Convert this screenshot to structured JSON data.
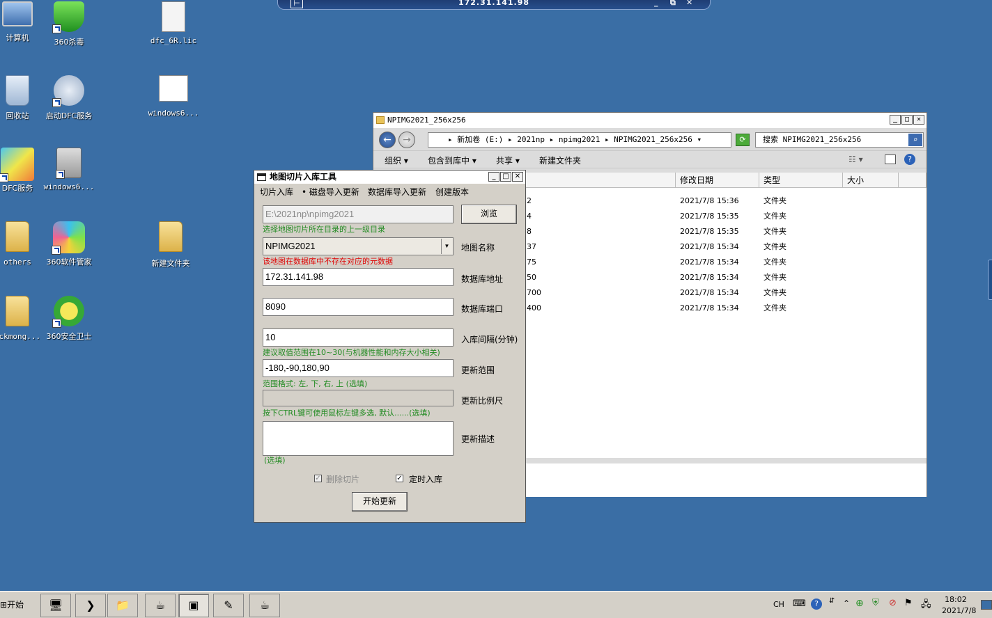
{
  "remote": {
    "ip": "172.31.141.98",
    "pin": "⊢",
    "min": "_",
    "restore": "⧉",
    "close": "✕"
  },
  "desktop": {
    "icons": [
      {
        "label": "计算机"
      },
      {
        "label": "360杀毒"
      },
      {
        "label": "dfc_6R.lic"
      },
      {
        "label": "回收站"
      },
      {
        "label": "启动DFC服务"
      },
      {
        "label": "windows6..."
      },
      {
        "label": "DFC服务"
      },
      {
        "label": "windows6..."
      },
      {
        "label": "others"
      },
      {
        "label": "360软件管家"
      },
      {
        "label": "新建文件夹"
      },
      {
        "label": "ockmong..."
      },
      {
        "label": "360安全卫士"
      }
    ]
  },
  "explorer": {
    "title": "NPIMG2021_256x256",
    "back": "←",
    "forward": "→",
    "address": "▸ 新加卷 (E:) ▸ 2021np ▸ npimg2021 ▸ NPIMG2021_256x256 ▾",
    "search_placeholder": "搜索 NPIMG2021_256x256",
    "toolbar": {
      "organize": "组织 ▾",
      "include": "包含到库中 ▾",
      "share": "共享 ▾",
      "new_folder": "新建文件夹"
    },
    "columns": {
      "modified": "修改日期",
      "type": "类型",
      "size": "大小"
    },
    "rows": [
      {
        "name": "2",
        "modified": "2021/7/8 15:36",
        "type": "文件夹"
      },
      {
        "name": "4",
        "modified": "2021/7/8 15:35",
        "type": "文件夹"
      },
      {
        "name": "8",
        "modified": "2021/7/8 15:35",
        "type": "文件夹"
      },
      {
        "name": "37",
        "modified": "2021/7/8 15:34",
        "type": "文件夹"
      },
      {
        "name": "75",
        "modified": "2021/7/8 15:34",
        "type": "文件夹"
      },
      {
        "name": "50",
        "modified": "2021/7/8 15:34",
        "type": "文件夹"
      },
      {
        "name": "700",
        "modified": "2021/7/8 15:34",
        "type": "文件夹"
      },
      {
        "name": "400",
        "modified": "2021/7/8 15:34",
        "type": "文件夹"
      }
    ]
  },
  "tool": {
    "title": "地图切片入库工具",
    "tabs": [
      "切片入库",
      "• 磁盘导入更新",
      "数据库导入更新",
      "创建版本"
    ],
    "path_value": "E:\\2021np\\npimg2021",
    "browse_label": "浏览",
    "path_hint": "选择地图切片所在目录的上一级目录",
    "map_name_value": "NPIMG2021",
    "map_name_label": "地图名称",
    "map_name_warning": "该地图在数据库中不存在对应的元数据",
    "db_addr_value": "172.31.141.98",
    "db_addr_label": "数据库地址",
    "db_port_value": "8090",
    "db_port_label": "数据库端口",
    "interval_value": "10",
    "interval_label": "入库间隔(分钟)",
    "interval_hint": "建议取值范围在10~30(与机器性能和内存大小相关)",
    "range_value": "-180,-90,180,90",
    "range_label": "更新范围",
    "range_hint": "范围格式: 左, 下, 右, 上 (选填)",
    "scale_label": "更新比例尺",
    "scale_hint": "按下CTRL键可使用鼠标左键多选, 默认......(选填)",
    "desc_label": "更新描述",
    "desc_hint": "(选填)",
    "delete_tiles_label": "删除切片",
    "timed_label": "定时入库",
    "start_label": "开始更新"
  },
  "taskbar": {
    "start_label": "开始",
    "lang": "CH",
    "time": "18:02",
    "date": "2021/7/8"
  }
}
